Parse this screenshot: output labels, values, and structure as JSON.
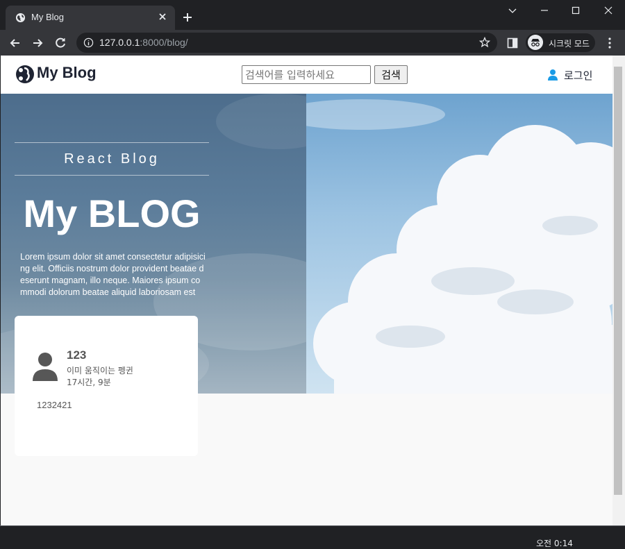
{
  "browser": {
    "tab_title": "My Blog",
    "url_host": "127.0.0.1",
    "url_path": ":8000/blog/",
    "incognito_label": "시크릿 모드",
    "clock": "오전 0:14"
  },
  "header": {
    "logo_text": "My Blog",
    "search_placeholder": "검색어를 입력하세요",
    "search_button": "검색",
    "login_label": "로그인"
  },
  "hero": {
    "subtitle": "React Blog",
    "title": "My BLOG",
    "description": "Lorem ipsum dolor sit amet consectetur adipisicing elit. Officiis nostrum dolor provident beatae deserunt magnam, illo neque. Maiores ipsum commodi dolorum beatae aliquid laboriosam est"
  },
  "post": {
    "author": "123",
    "subtitle": "이미 움직이는 펭귄",
    "time": "17시간, 9분",
    "body": "1232421"
  },
  "colors": {
    "brand_dark": "#1f2433",
    "login_icon": "#1a9be6",
    "chrome_bg": "#202124",
    "toolbar_bg": "#35363a"
  }
}
